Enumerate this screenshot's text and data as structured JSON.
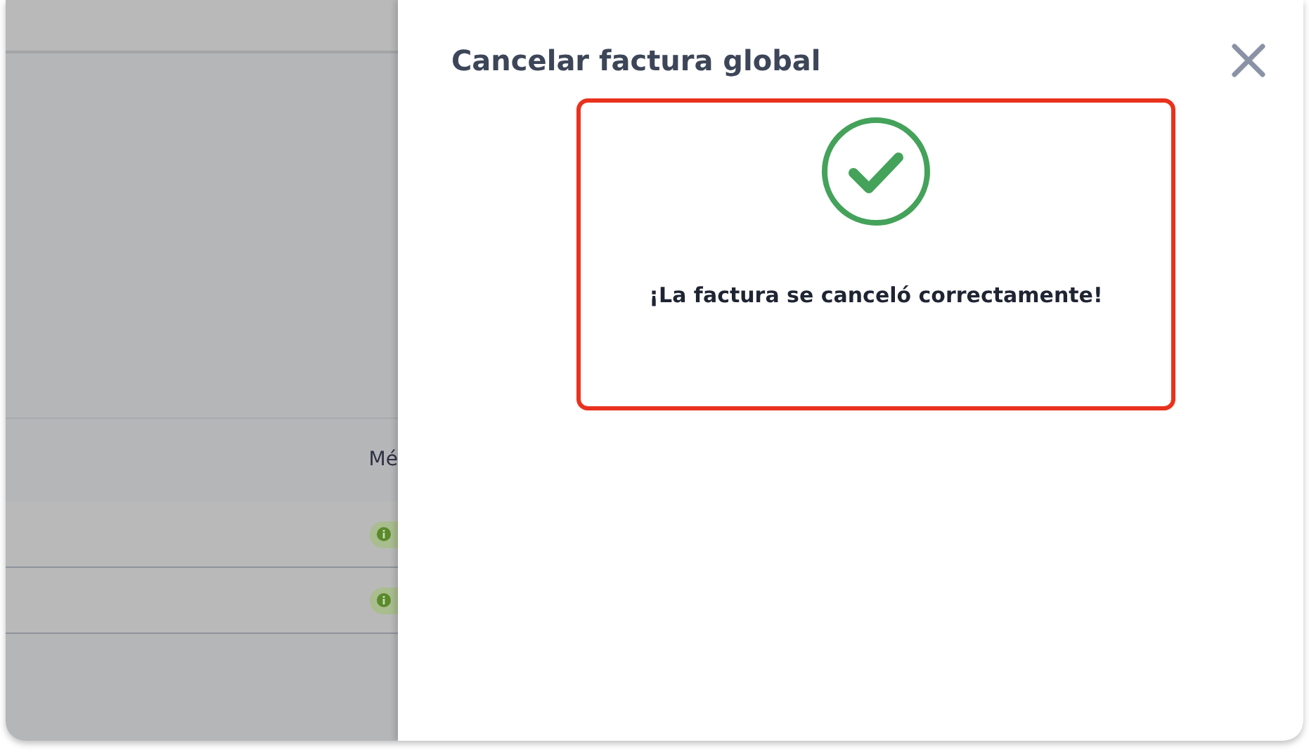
{
  "background_table": {
    "columns": [
      {
        "label": "Mé"
      }
    ],
    "rows": [
      {
        "kind": "status-badge"
      },
      {
        "kind": "status-badge"
      }
    ]
  },
  "drawer": {
    "title": "Cancelar factura global",
    "message": {
      "kind": "success",
      "text": "¡La factura se canceló correctamente!",
      "highlighted": true
    }
  }
}
